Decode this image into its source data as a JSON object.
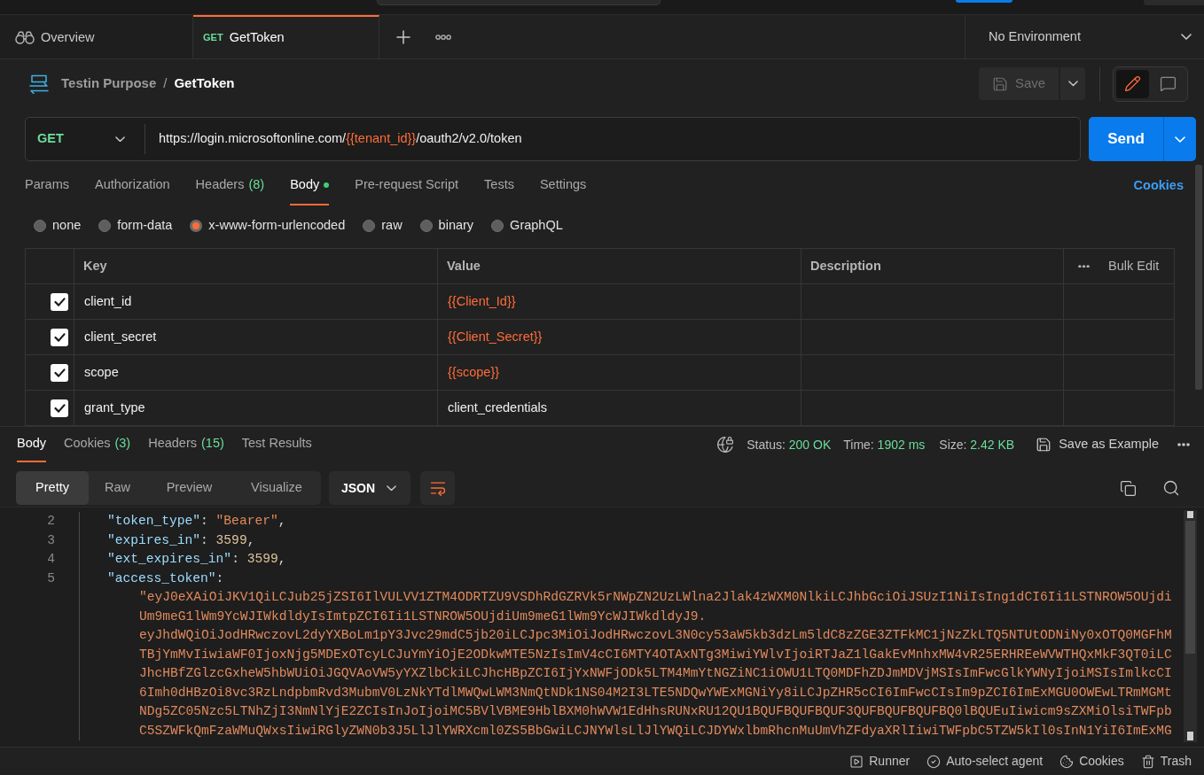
{
  "tabs": [
    {
      "kind": "overview",
      "label": "Overview",
      "selected": false
    },
    {
      "kind": "request",
      "method": "GET",
      "label": "GetToken",
      "selected": true
    }
  ],
  "environment": {
    "label": "No Environment"
  },
  "breadcrumb": {
    "collection": "Testin Purpose",
    "separator": "/",
    "request": "GetToken"
  },
  "save_button": {
    "label": "Save",
    "disabled": true
  },
  "mode_toggle": [
    {
      "kind": "edit",
      "selected": true
    },
    {
      "kind": "comments",
      "selected": false
    }
  ],
  "request": {
    "method": "GET",
    "url": [
      {
        "kind": "text",
        "text": "https://login.microsoftonline.com/"
      },
      {
        "kind": "variable",
        "text": "{{tenant_id}}"
      },
      {
        "kind": "text",
        "text": "/oauth2/v2.0/token"
      }
    ],
    "send": "Send"
  },
  "request_tabs": [
    {
      "label": "Params",
      "selected": false,
      "dot": false
    },
    {
      "label": "Authorization",
      "selected": false,
      "dot": false
    },
    {
      "label": "Headers",
      "count": "(8)",
      "selected": false,
      "dot": false
    },
    {
      "label": "Body",
      "selected": true,
      "dot": true
    },
    {
      "label": "Pre-request Script",
      "selected": false,
      "dot": false
    },
    {
      "label": "Tests",
      "selected": false,
      "dot": false
    },
    {
      "label": "Settings",
      "selected": false,
      "dot": false
    }
  ],
  "cookies_link": "Cookies",
  "body_types": [
    {
      "label": "none",
      "selected": false
    },
    {
      "label": "form-data",
      "selected": false
    },
    {
      "label": "x-www-form-urlencoded",
      "selected": true
    },
    {
      "label": "raw",
      "selected": false
    },
    {
      "label": "binary",
      "selected": false
    },
    {
      "label": "GraphQL",
      "selected": false
    }
  ],
  "params_table": {
    "columns": [
      "Key",
      "Value",
      "Description"
    ],
    "bulk_edit": "Bulk Edit",
    "rows": [
      {
        "checked": true,
        "key": "client_id",
        "value": "{{Client_Id}}",
        "variable": true
      },
      {
        "checked": true,
        "key": "client_secret",
        "value": "{{Client_Secret}}",
        "variable": true
      },
      {
        "checked": true,
        "key": "scope",
        "value": "{{scope}}",
        "variable": true
      },
      {
        "checked": true,
        "key": "grant_type",
        "value": "client_credentials",
        "variable": false
      }
    ]
  },
  "response": {
    "tabs": [
      {
        "label": "Body",
        "selected": true
      },
      {
        "label": "Cookies",
        "count": "(3)",
        "selected": false
      },
      {
        "label": "Headers",
        "count": "(15)",
        "selected": false
      },
      {
        "label": "Test Results",
        "selected": false
      }
    ],
    "status": {
      "label": "Status:",
      "value": "200 OK"
    },
    "time": {
      "label": "Time:",
      "value": "1902 ms"
    },
    "size": {
      "label": "Size:",
      "value": "2.42 KB"
    },
    "save_example": "Save as Example",
    "view_modes": [
      {
        "label": "Pretty",
        "selected": true
      },
      {
        "label": "Raw",
        "selected": false
      },
      {
        "label": "Preview",
        "selected": false
      },
      {
        "label": "Visualize",
        "selected": false
      }
    ],
    "format": "JSON",
    "lines": [
      {
        "number": "2",
        "segments": [
          {
            "kind": "key",
            "text": "\"token_type\""
          },
          {
            "kind": "punct",
            "text": ": "
          },
          {
            "kind": "string",
            "text": "\"Bearer\""
          },
          {
            "kind": "punct",
            "text": ","
          }
        ]
      },
      {
        "number": "3",
        "segments": [
          {
            "kind": "key",
            "text": "\"expires_in\""
          },
          {
            "kind": "punct",
            "text": ": "
          },
          {
            "kind": "number",
            "text": "3599"
          },
          {
            "kind": "punct",
            "text": ","
          }
        ]
      },
      {
        "number": "4",
        "segments": [
          {
            "kind": "key",
            "text": "\"ext_expires_in\""
          },
          {
            "kind": "punct",
            "text": ": "
          },
          {
            "kind": "number",
            "text": "3599"
          },
          {
            "kind": "punct",
            "text": ","
          }
        ]
      },
      {
        "number": "5",
        "segments": [
          {
            "kind": "key",
            "text": "\"access_token\""
          },
          {
            "kind": "punct",
            "text": ":"
          }
        ],
        "wrapped": [
          "\"eyJ0eXAiOiJKV1QiLCJub25jZSI6IlVULVV1ZTM4ODRTZU9VSDhRdGZRVk5rNWpZN2UzLWlna2Jlak4zWXM0NlkiLCJhbGciOiJSUzI1NiIsIng1dCI6Ii1LSTNROW5OUjdi",
          "Um9meG1lWm9YcWJIWkdldyIsImtpZCI6Ii1LSTNROW5OUjdiUm9meG1lWm9YcWJIWkdldyJ9.",
          "eyJhdWQiOiJodHRwczovL2dyYXBoLm1pY3Jvc29mdC5jb20iLCJpc3MiOiJodHRwczovL3N0cy53aW5kb3dzLm5ldC8zZGE3ZTFkMC1jNzZkLTQ5NTUtODNiNy0xOTQ0MGFhM",
          "TBjYmMvIiwiaWF0IjoxNjg5MDExOTcyLCJuYmYiOjE2ODkwMTE5NzIsImV4cCI6MTY4OTAxNTg3MiwiYWlvIjoiRTJaZ1lGakEvMnhxMW4vR25ERHREeWVWTHQxMkF3QT0iLC",
          "JhcHBfZGlzcGxheW5hbWUiOiJGQVAoVW5yYXZlbCkiLCJhcHBpZCI6IjYxNWFjODk5LTM4MmYtNGZiNC1iOWU1LTQ0MDFhZDJmMDVjMSIsImFwcGlkYWNyIjoiMSIsImlkcCI",
          "6Imh0dHBzOi8vc3RzLndpbmRvd3MubmV0LzNkYTdlMWQwLWM3NmQtNDk1NS04M2I3LTE5NDQwYWExMGNiYy8iLCJpZHR5cCI6ImFwcCIsIm9pZCI6ImExMGU0OWEwLTRmMGMt",
          "NDg5ZC05Nzc5LTNhZjI3NmNlYjE2ZCIsInJoIjoiMC5BVlVBME9HblBXM0hWVW1EdHhsRUNxRU12QU1BQUFBQUFBQUF3QUFBQUFBQUFBQ0lBQUEuIiwicm9sZXMiOlsiTWFpb",
          "C5SZWFkQmFzaWMuQWxsIiwiRGlyZWN0b3J5LlJlYWRXcml0ZS5BbGwiLCJNYWlsLlJlYWQiLCJDYWxlbmRhcnMuUmVhZFdyaXRlIiwiTWFpbC5TZW5kIl0sInN1YiI6ImExMG"
        ]
      }
    ]
  },
  "status_bar": [
    {
      "kind": "runner",
      "label": "Runner"
    },
    {
      "kind": "agent",
      "label": "Auto-select agent"
    },
    {
      "kind": "cookies",
      "label": "Cookies"
    },
    {
      "kind": "trash",
      "label": "Trash"
    }
  ]
}
